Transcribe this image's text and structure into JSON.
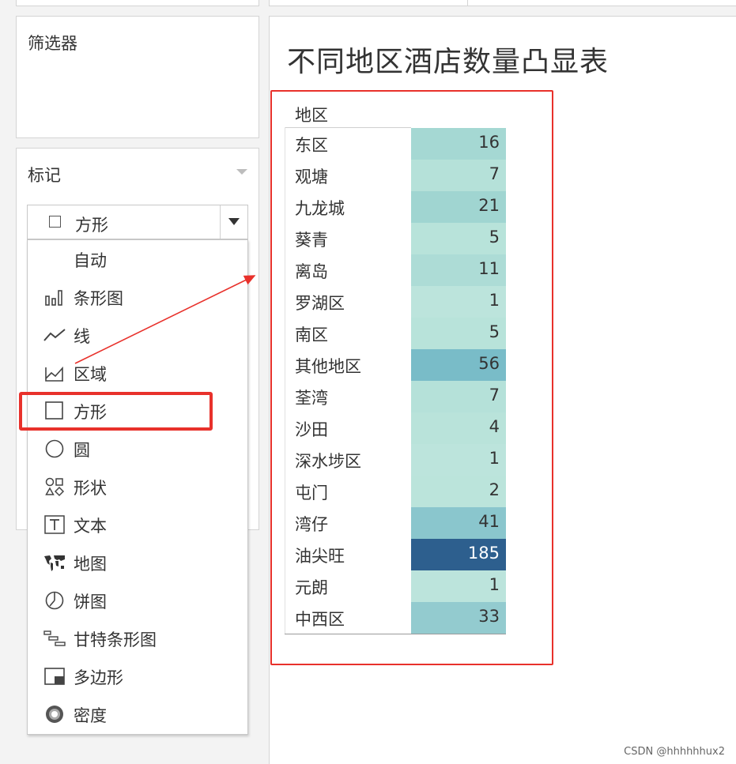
{
  "filters": {
    "title": "筛选器"
  },
  "marks": {
    "title": "标记",
    "selected_type": "方形",
    "menu": [
      {
        "label": "自动",
        "icon": ""
      },
      {
        "label": "条形图",
        "icon": "bar-chart-icon"
      },
      {
        "label": "线",
        "icon": "line-icon"
      },
      {
        "label": "区域",
        "icon": "area-icon"
      },
      {
        "label": "方形",
        "icon": "square-icon"
      },
      {
        "label": "圆",
        "icon": "circle-icon"
      },
      {
        "label": "形状",
        "icon": "shapes-icon"
      },
      {
        "label": "文本",
        "icon": "text-icon"
      },
      {
        "label": "地图",
        "icon": "map-icon"
      },
      {
        "label": "饼图",
        "icon": "pie-icon"
      },
      {
        "label": "甘特条形图",
        "icon": "gantt-icon"
      },
      {
        "label": "多边形",
        "icon": "polygon-icon"
      },
      {
        "label": "密度",
        "icon": "density-icon"
      }
    ]
  },
  "viz": {
    "title": "不同地区酒店数量凸显表",
    "column_header": "地区",
    "rows": [
      {
        "region": "东区",
        "count": "16",
        "color": "#a5d8d3"
      },
      {
        "region": "观塘",
        "count": "7",
        "color": "#b5e1d9"
      },
      {
        "region": "九龙城",
        "count": "21",
        "color": "#a0d5d1"
      },
      {
        "region": "葵青",
        "count": "5",
        "color": "#b8e3da"
      },
      {
        "region": "离岛",
        "count": "11",
        "color": "#addcd6"
      },
      {
        "region": "罗湖区",
        "count": "1",
        "color": "#bce4dc"
      },
      {
        "region": "南区",
        "count": "5",
        "color": "#b8e3da"
      },
      {
        "region": "其他地区",
        "count": "56",
        "color": "#79bcc8"
      },
      {
        "region": "荃湾",
        "count": "7",
        "color": "#b5e1d9"
      },
      {
        "region": "沙田",
        "count": "4",
        "color": "#b9e3da"
      },
      {
        "region": "深水埗区",
        "count": "1",
        "color": "#bce4dc"
      },
      {
        "region": "屯门",
        "count": "2",
        "color": "#bbe4db"
      },
      {
        "region": "湾仔",
        "count": "41",
        "color": "#8ac6cd"
      },
      {
        "region": "油尖旺",
        "count": "185",
        "color": "#2d5f8e",
        "text_color": "#ffffff"
      },
      {
        "region": "元朗",
        "count": "1",
        "color": "#bce4dc"
      },
      {
        "region": "中西区",
        "count": "33",
        "color": "#93cbcf"
      }
    ]
  },
  "watermark": "CSDN @hhhhhhux2",
  "accent_color": "#e8312b"
}
